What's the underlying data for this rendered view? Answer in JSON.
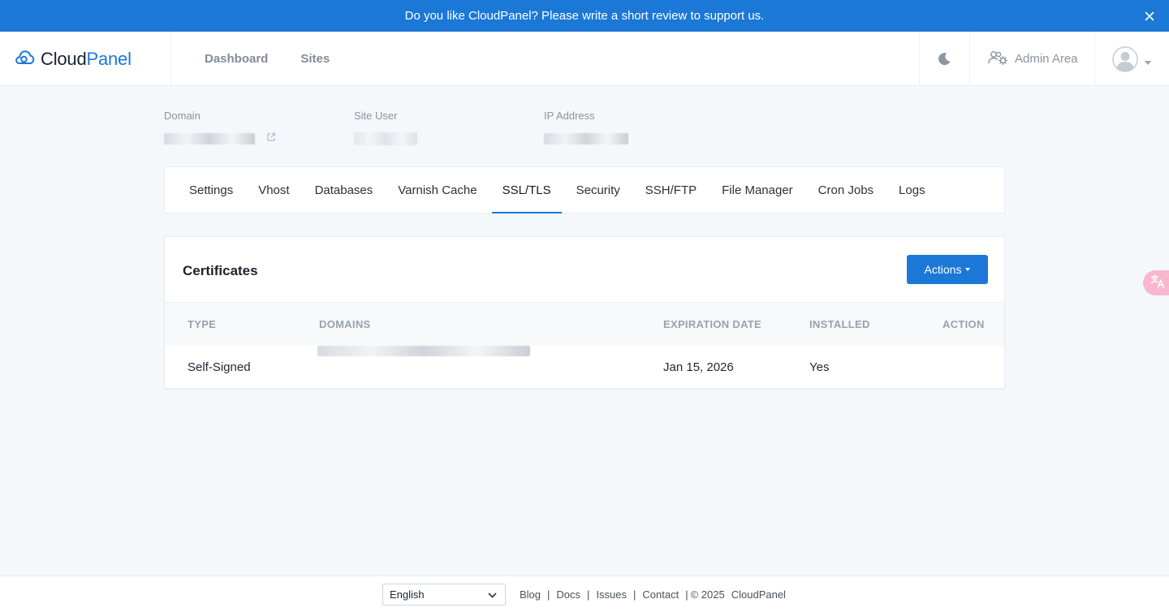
{
  "banner": {
    "text": "Do you like CloudPanel? Please write a short review to support us."
  },
  "brand": {
    "part1": "Cloud",
    "part2": "Panel"
  },
  "nav": {
    "dashboard": "Dashboard",
    "sites": "Sites"
  },
  "header": {
    "admin_area": "Admin Area"
  },
  "site": {
    "domain_label": "Domain",
    "site_user_label": "Site User",
    "ip_label": "IP Address"
  },
  "tabs": [
    {
      "label": "Settings"
    },
    {
      "label": "Vhost"
    },
    {
      "label": "Databases"
    },
    {
      "label": "Varnish Cache"
    },
    {
      "label": "SSL/TLS",
      "active": true
    },
    {
      "label": "Security"
    },
    {
      "label": "SSH/FTP"
    },
    {
      "label": "File Manager"
    },
    {
      "label": "Cron Jobs"
    },
    {
      "label": "Logs"
    }
  ],
  "certificates": {
    "title": "Certificates",
    "actions_label": "Actions",
    "columns": {
      "type": "TYPE",
      "domains": "DOMAINS",
      "expiration": "EXPIRATION DATE",
      "installed": "INSTALLED",
      "action": "ACTION"
    },
    "rows": [
      {
        "type": "Self-Signed",
        "expiration": "Jan 15, 2026",
        "installed": "Yes"
      }
    ]
  },
  "footer": {
    "language": "English",
    "blog": "Blog",
    "docs": "Docs",
    "issues": "Issues",
    "contact": "Contact",
    "copyright": "© 2025",
    "brand": "CloudPanel"
  },
  "colors": {
    "primary": "#1b78d6",
    "background": "#f5f8fb"
  }
}
